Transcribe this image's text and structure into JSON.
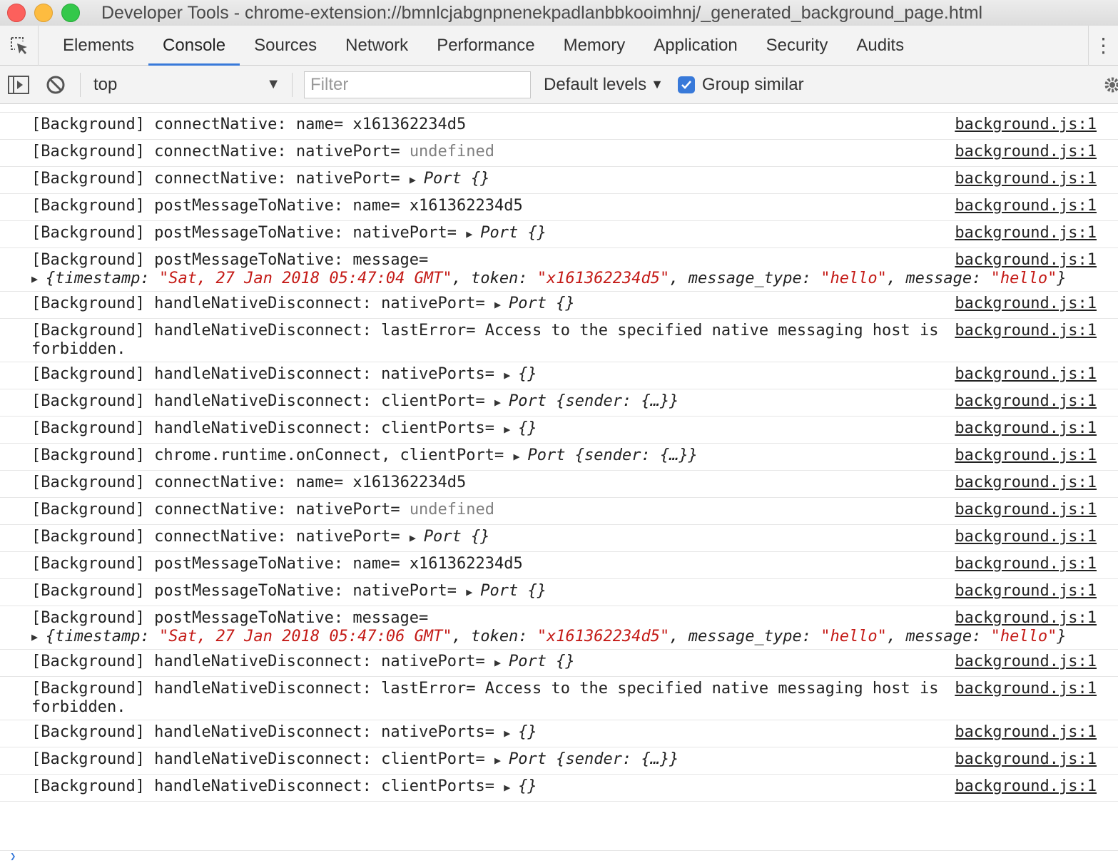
{
  "window": {
    "title": "Developer Tools - chrome-extension://bmnlcjabgnpnenekpadlanbbkooimhnj/_generated_background_page.html"
  },
  "tabs": [
    {
      "label": "Elements"
    },
    {
      "label": "Console"
    },
    {
      "label": "Sources"
    },
    {
      "label": "Network"
    },
    {
      "label": "Performance"
    },
    {
      "label": "Memory"
    },
    {
      "label": "Application"
    },
    {
      "label": "Security"
    },
    {
      "label": "Audits"
    }
  ],
  "active_tab": "Console",
  "toolbar": {
    "context": "top",
    "filter_placeholder": "Filter",
    "levels_label": "Default levels",
    "group_similar_label": "Group similar",
    "group_similar_checked": true
  },
  "source_label": "background.js:1",
  "messages": [
    {
      "type": "plain",
      "prefix": "[Background] connectNative: name= ",
      "value": "x161362234d5"
    },
    {
      "type": "undef",
      "prefix": "[Background] connectNative: nativePort= ",
      "value": "undefined"
    },
    {
      "type": "obj",
      "prefix": "[Background] connectNative: nativePort= ",
      "value": "Port {}"
    },
    {
      "type": "plain",
      "prefix": "[Background] postMessageToNative: name= ",
      "value": "x161362234d5"
    },
    {
      "type": "obj",
      "prefix": "[Background] postMessageToNative: nativePort= ",
      "value": "Port {}"
    },
    {
      "type": "message",
      "prefix": "[Background] postMessageToNative: message=",
      "fields": [
        {
          "key": "timestamp",
          "value": "\"Sat, 27 Jan 2018 05:47:04 GMT\""
        },
        {
          "key": "token",
          "value": "\"x161362234d5\""
        },
        {
          "key": "message_type",
          "value": "\"hello\""
        },
        {
          "key": "message",
          "value": "\"hello\""
        }
      ]
    },
    {
      "type": "obj",
      "prefix": "[Background] handleNativeDisconnect: nativePort= ",
      "value": "Port {}"
    },
    {
      "type": "plain",
      "prefix": "[Background] handleNativeDisconnect: lastError= ",
      "value": "Access to the specified native messaging host is forbidden."
    },
    {
      "type": "obj",
      "prefix": "[Background] handleNativeDisconnect: nativePorts= ",
      "value": "{}"
    },
    {
      "type": "obj",
      "prefix": "[Background] handleNativeDisconnect: clientPort= ",
      "value": "Port {sender: {…}}"
    },
    {
      "type": "obj",
      "prefix": "[Background] handleNativeDisconnect: clientPorts= ",
      "value": "{}"
    },
    {
      "type": "obj",
      "prefix": "[Background] chrome.runtime.onConnect, clientPort= ",
      "value": "Port {sender: {…}}"
    },
    {
      "type": "plain",
      "prefix": "[Background] connectNative: name= ",
      "value": "x161362234d5"
    },
    {
      "type": "undef",
      "prefix": "[Background] connectNative: nativePort= ",
      "value": "undefined"
    },
    {
      "type": "obj",
      "prefix": "[Background] connectNative: nativePort= ",
      "value": "Port {}"
    },
    {
      "type": "plain",
      "prefix": "[Background] postMessageToNative: name= ",
      "value": "x161362234d5"
    },
    {
      "type": "obj",
      "prefix": "[Background] postMessageToNative: nativePort= ",
      "value": "Port {}"
    },
    {
      "type": "message",
      "prefix": "[Background] postMessageToNative: message=",
      "fields": [
        {
          "key": "timestamp",
          "value": "\"Sat, 27 Jan 2018 05:47:06 GMT\""
        },
        {
          "key": "token",
          "value": "\"x161362234d5\""
        },
        {
          "key": "message_type",
          "value": "\"hello\""
        },
        {
          "key": "message",
          "value": "\"hello\""
        }
      ]
    },
    {
      "type": "obj",
      "prefix": "[Background] handleNativeDisconnect: nativePort= ",
      "value": "Port {}"
    },
    {
      "type": "plain",
      "prefix": "[Background] handleNativeDisconnect: lastError= ",
      "value": "Access to the specified native messaging host is forbidden."
    },
    {
      "type": "obj",
      "prefix": "[Background] handleNativeDisconnect: nativePorts= ",
      "value": "{}"
    },
    {
      "type": "obj",
      "prefix": "[Background] handleNativeDisconnect: clientPort= ",
      "value": "Port {sender: {…}}"
    },
    {
      "type": "obj",
      "prefix": "[Background] handleNativeDisconnect: clientPorts= ",
      "value": "{}"
    }
  ],
  "colors": {
    "accent": "#3879d9",
    "string": "#c41a16",
    "undefined": "#808080"
  }
}
